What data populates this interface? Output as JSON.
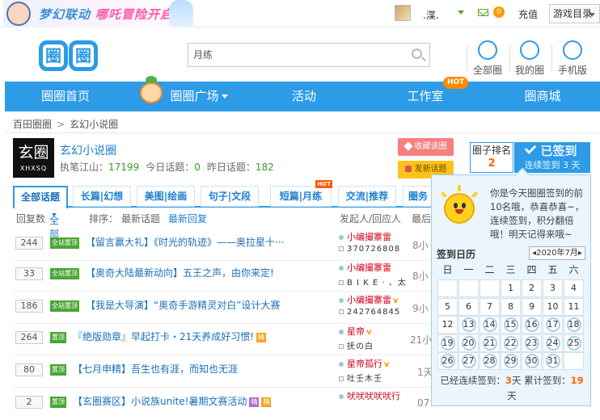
{
  "topbar": {
    "banner_left": "梦幻联动",
    "banner_right": "哪吒冒险开启",
    "user_name": ".渫.",
    "mail_count": "0",
    "recharge": "充值",
    "game_login": "游戏目录"
  },
  "header": {
    "logo_text": "圈",
    "search_value": "月练",
    "quick_links": [
      "全部圈",
      "我的圈",
      "手机版"
    ]
  },
  "nav": {
    "items": [
      "圈圈首页",
      "圈圈广场",
      "活动",
      "工作室",
      "圈商城"
    ],
    "hot_label": "HOT"
  },
  "breadcrumb": {
    "items": [
      "百田圈圈",
      "玄幻小说圈"
    ],
    "separator": ">"
  },
  "circle": {
    "logo_big": "玄圈",
    "logo_small": "XHXSQ",
    "name": "玄幻小说圈",
    "owner_label": "执笔江山：",
    "owner_count": "17199",
    "today_label": "今日话题：",
    "today_count": "0",
    "yesterday_label": "昨日话题：",
    "yesterday_count": "182",
    "fav_button": "收藏该圈",
    "post_button": "发新话题"
  },
  "checkin": {
    "rank_label": "圈子排名",
    "rank_value": "2",
    "sign_label": "已签到",
    "sign_days_prefix": "连续签到",
    "sign_days": "3",
    "sign_days_suffix": "天"
  },
  "tabs": {
    "items": [
      "全部话题",
      "长篇|幻想",
      "美图|绘画",
      "句子|文段",
      "短篇|月练",
      "交流|推荐",
      "圈务"
    ],
    "hot_tag": "HOT"
  },
  "list": {
    "head_replies": "回复数",
    "head_all": "全部",
    "head_sort": "排序：",
    "head_latest_topic": "最新话题",
    "head_latest_reply": "最新回复",
    "head_author": "发起人/回应人",
    "head_last": "最后",
    "rows": [
      {
        "count": "244",
        "tag": "全站置顶",
        "title": "【留言赢大礼】《时光的轨迹》——奥拉星十···",
        "author": "小编撮寨雷",
        "replier": "370726808",
        "time": "8小"
      },
      {
        "count": "33",
        "tag": "全站置顶",
        "title": "【奥奇大陆最新动向】五王之声，由你来定!",
        "author": "小编撮寨雷",
        "replier": "B I K E · 、太",
        "time": "8小"
      },
      {
        "count": "186",
        "tag": "全站置顶",
        "title": "【我是大导演】“奥奇手游精灵对白”设计大赛",
        "author": "小编撮寨雷",
        "replier": "242764845",
        "time": "9小"
      },
      {
        "count": "264",
        "tag": "置顶",
        "title": "『绝版勋章』早起打卡・21天养成好习惯!",
        "author": "星帝",
        "replier": "抚の白",
        "time": "21小",
        "small_tag": "精"
      },
      {
        "count": "80",
        "tag": "置顶",
        "title": "【七月申精】吾生也有涯，而知也无涯",
        "author": "星帝孤行",
        "replier": "吐壬木壬",
        "time": "1天"
      },
      {
        "count": "2",
        "tag": "置顶",
        "title": "【玄圈赛区】小说族unite!暑期文赛活动",
        "author": "吠吠吠吠吠行",
        "replier": "",
        "time": "07",
        "small_tag": "精",
        "small_tag2": "精"
      }
    ]
  },
  "popup": {
    "message": "你是今天圈圈签到的前10名哦，恭喜恭喜~，连续签到，积分翻倍哦！明天记得来哦~",
    "calendar_title": "签到日历",
    "month": "◂2020年7月▸",
    "weekdays": [
      "日",
      "一",
      "二",
      "三",
      "四",
      "五",
      "六"
    ],
    "days": [
      "",
      "",
      "",
      "1",
      "2",
      "3",
      "4",
      "5",
      "6",
      "7",
      "8",
      "9",
      "10",
      "11",
      "12",
      "13",
      "14",
      "15",
      "16",
      "17",
      "18",
      "19",
      "20",
      "21",
      "22",
      "23",
      "24",
      "25",
      "26",
      "27",
      "28",
      "29",
      "30",
      "31",
      ""
    ],
    "signed_days": [
      "13",
      "14",
      "15",
      "16",
      "17",
      "18",
      "19",
      "20",
      "21",
      "22",
      "23",
      "24",
      "25",
      "26",
      "27",
      "28",
      "29",
      "30",
      "31"
    ],
    "footer_prefix": "已经连续签到：",
    "footer_streak": "3",
    "footer_mid": "天  累计签到：",
    "footer_total": "19",
    "footer_suffix": "天"
  },
  "colors": {
    "primary": "#2d9be6",
    "accent": "#ff6600",
    "green": "#3c9a2a"
  }
}
